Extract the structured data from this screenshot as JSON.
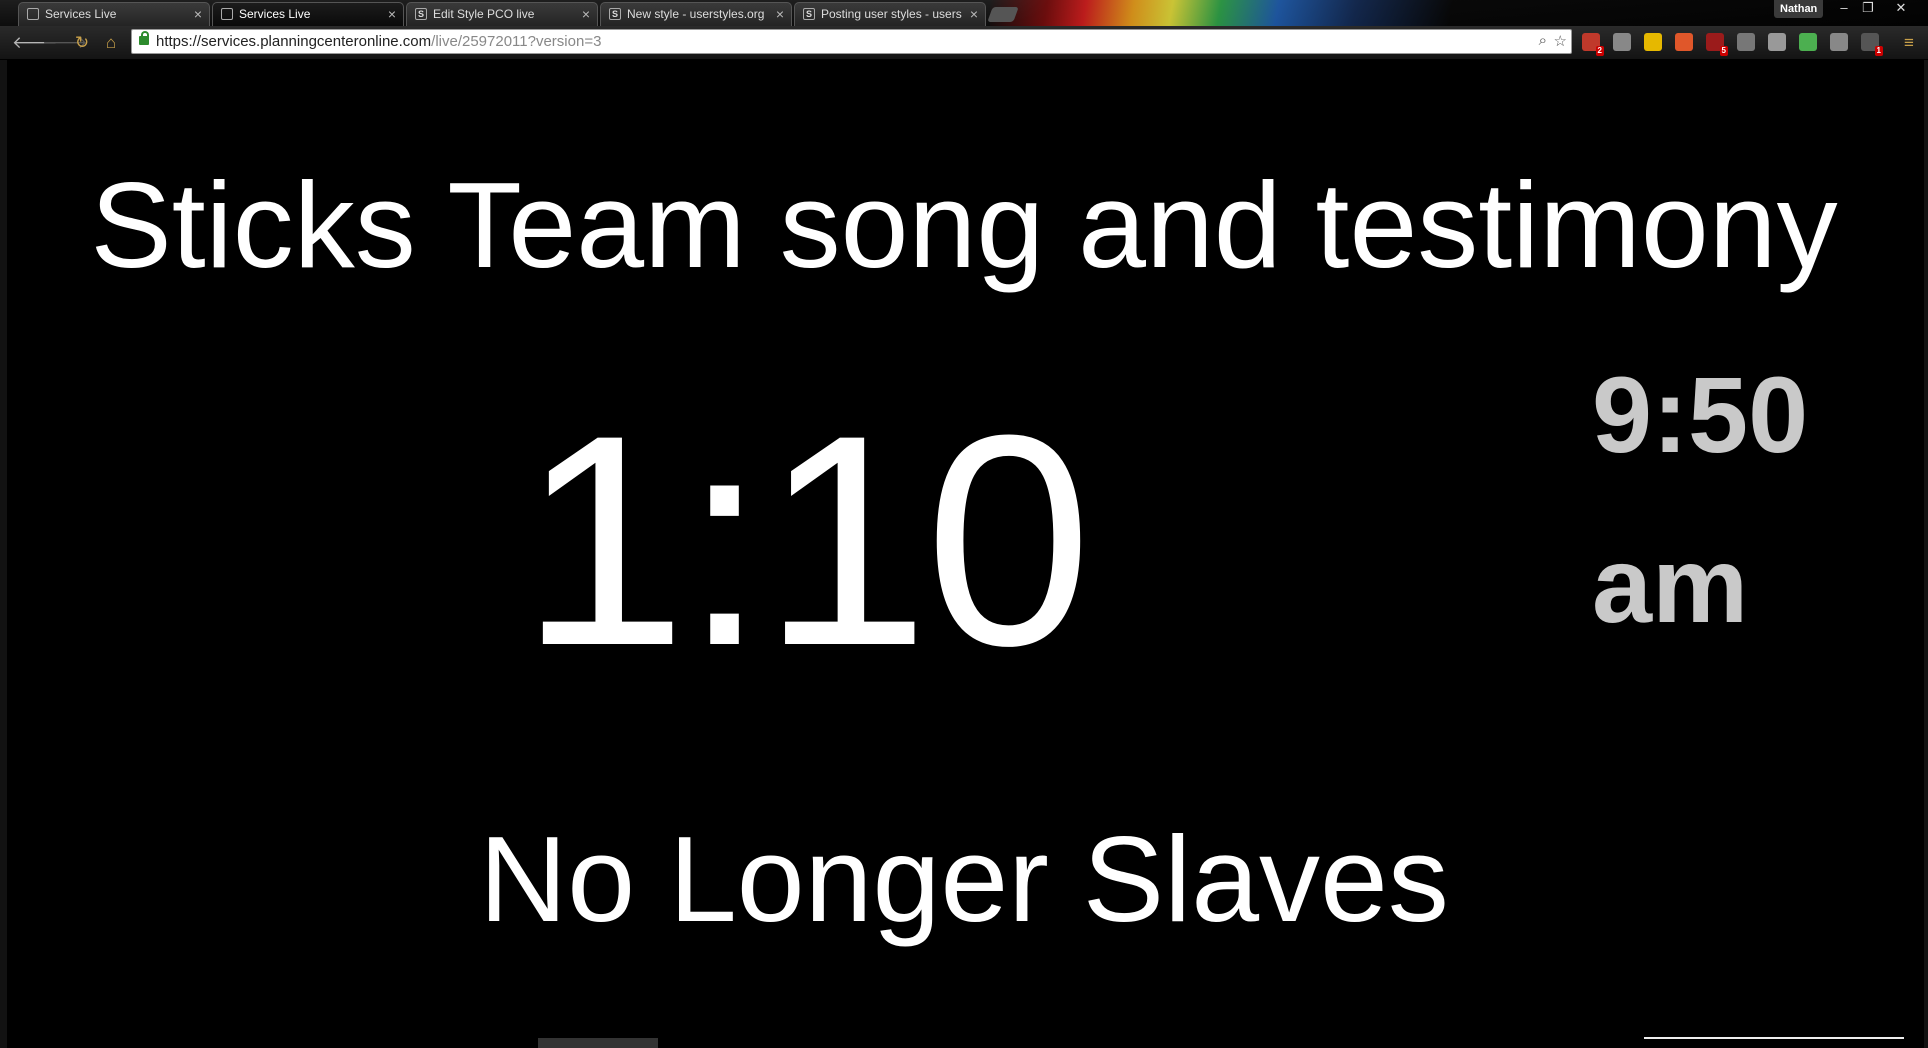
{
  "browser": {
    "tabs": [
      {
        "label": "Services Live",
        "favicon": "page-icon",
        "active": false
      },
      {
        "label": "Services Live",
        "favicon": "page-icon",
        "active": true
      },
      {
        "label": "Edit Style PCO live",
        "favicon": "userstyles-icon",
        "active": false
      },
      {
        "label": "New style - userstyles.org",
        "favicon": "userstyles-icon",
        "active": false
      },
      {
        "label": "Posting user styles - users",
        "favicon": "userstyles-icon",
        "active": false
      }
    ],
    "profile_name": "Nathan",
    "url": {
      "host": "https://services.planningcenteronline.com",
      "path": "/live/25972011?version=3"
    },
    "extensions": [
      {
        "name": "lastpass-icon",
        "badge": "2",
        "color": "#c0392b"
      },
      {
        "name": "mail-icon",
        "badge": "",
        "color": "#888888"
      },
      {
        "name": "pushbullet-icon",
        "badge": "",
        "color": "#e6b800"
      },
      {
        "name": "firefox-sync-icon",
        "badge": "",
        "color": "#e0572a"
      },
      {
        "name": "ublock-icon",
        "badge": "5",
        "color": "#9b1b1b"
      },
      {
        "name": "image-icon",
        "badge": "",
        "color": "#777777"
      },
      {
        "name": "drive-icon",
        "badge": "",
        "color": "#999999"
      },
      {
        "name": "evernote-icon",
        "badge": "",
        "color": "#4caf50"
      },
      {
        "name": "window-icon",
        "badge": "",
        "color": "#888888"
      },
      {
        "name": "stylish-icon",
        "badge": "1",
        "color": "#555555"
      }
    ]
  },
  "live": {
    "item_title": "Sticks Team song and testimony",
    "countdown": "1:10",
    "clock_time": "9:50",
    "clock_ampm": "am",
    "next_song": "No Longer Slaves"
  },
  "colors": {
    "background": "#000000",
    "primary_text": "#ffffff",
    "clock_text": "#c9c9c9"
  }
}
